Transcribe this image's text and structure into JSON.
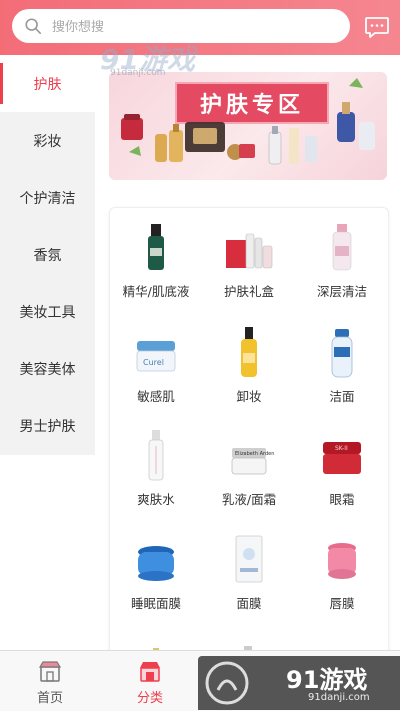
{
  "search": {
    "placeholder": "搜你想搜",
    "icon": "search-icon"
  },
  "header": {
    "message_icon": "chat-bubble-icon"
  },
  "watermark": {
    "logo_text": "91游戏",
    "domain": "91danji.com"
  },
  "sidebar": {
    "items": [
      {
        "label": "护肤",
        "active": true
      },
      {
        "label": "彩妆",
        "active": false
      },
      {
        "label": "个护清洁",
        "active": false
      },
      {
        "label": "香氛",
        "active": false
      },
      {
        "label": "美妆工具",
        "active": false
      },
      {
        "label": "美容美体",
        "active": false
      },
      {
        "label": "男士护肤",
        "active": false
      }
    ]
  },
  "banner": {
    "title": "护肤专区"
  },
  "categories": [
    {
      "label": "精华/肌底液",
      "icon": "serum-bottle-icon"
    },
    {
      "label": "护肤礼盒",
      "icon": "gift-set-icon"
    },
    {
      "label": "深层清洁",
      "icon": "cleanser-bottle-icon"
    },
    {
      "label": "敏感肌",
      "icon": "cream-jar-icon"
    },
    {
      "label": "卸妆",
      "icon": "oil-bottle-icon"
    },
    {
      "label": "洁面",
      "icon": "cleanser-pump-icon"
    },
    {
      "label": "爽肤水",
      "icon": "toner-bottle-icon"
    },
    {
      "label": "乳液/面霜",
      "icon": "face-cream-icon"
    },
    {
      "label": "眼霜",
      "icon": "eye-cream-jar-icon"
    },
    {
      "label": "睡眠面膜",
      "icon": "sleeping-mask-jar-icon"
    },
    {
      "label": "面膜",
      "icon": "sheet-mask-box-icon"
    },
    {
      "label": "唇膜",
      "icon": "lip-mask-jar-icon"
    }
  ],
  "tabbar": {
    "items": [
      {
        "label": "首页",
        "icon": "shop-icon",
        "active": false
      },
      {
        "label": "分类",
        "icon": "category-store-icon",
        "active": true
      }
    ]
  },
  "colors": {
    "accent": "#ee3f4d",
    "header_gradient_start": "#f36d77",
    "header_gradient_end": "#f58690"
  }
}
